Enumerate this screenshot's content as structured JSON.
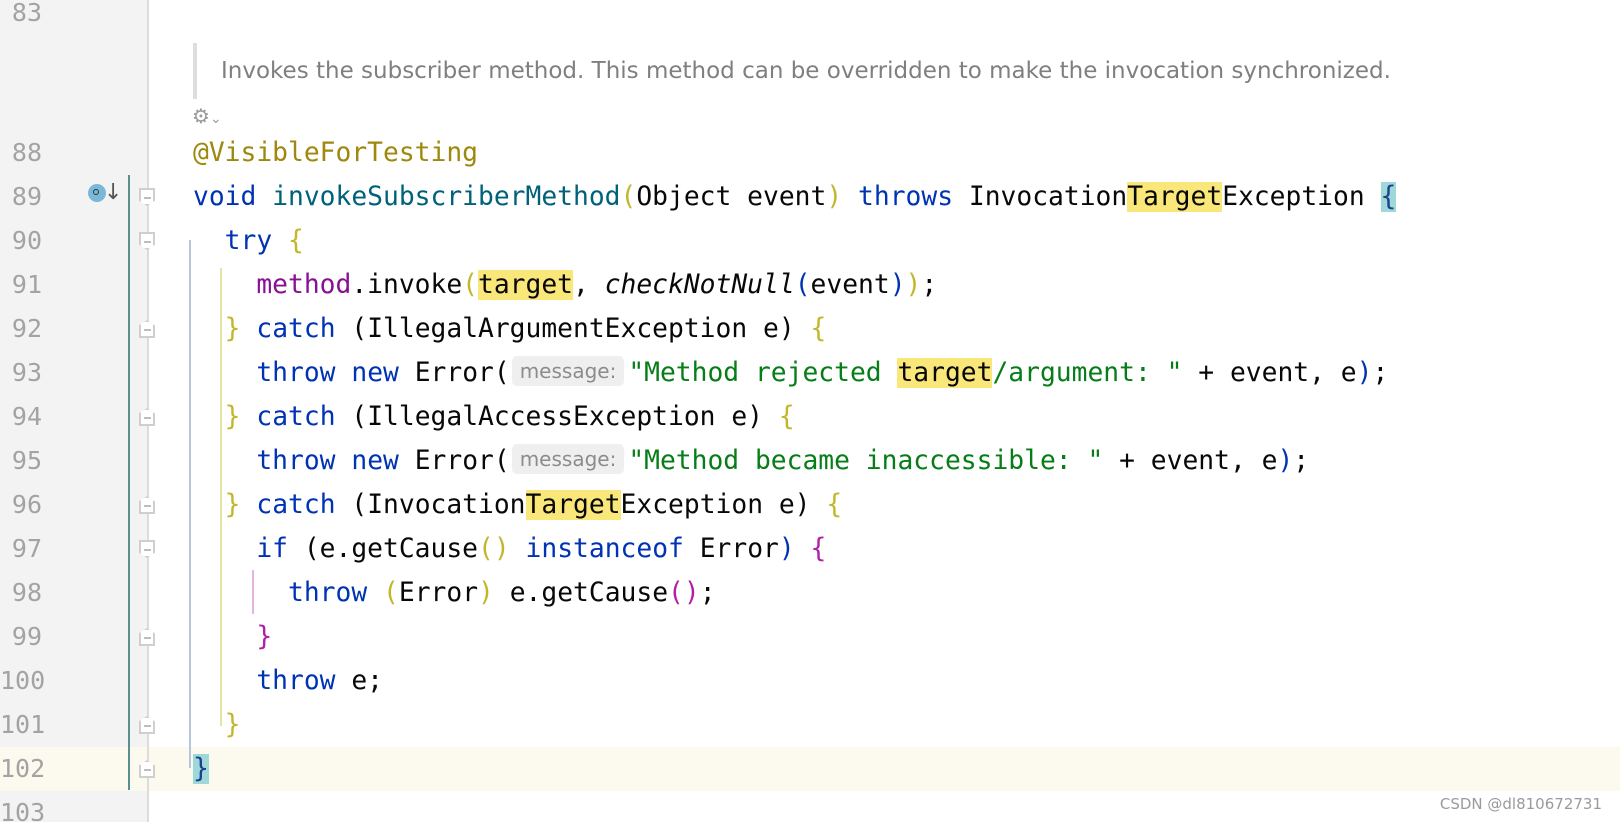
{
  "editor": {
    "doc_comment": "Invokes the subscriber method. This method can be overridden to make the invocation synchronized.",
    "doc_toggle_icon": "render-doc-icon",
    "current_line": 102,
    "watermark": "CSDN @dl810672731",
    "colors": {
      "keyword": "#0033b3",
      "method": "#00627a",
      "annotation": "#9e880d",
      "string": "#067d17",
      "field": "#871094",
      "highlight": "#f9e77a",
      "current_line": "#fcfaee",
      "brace_match": "#9fd8d8"
    },
    "lines": [
      {
        "n": "83",
        "tokens": []
      },
      {
        "n": "88",
        "tokens": [
          [
            "@VisibleForTesting",
            "ann"
          ]
        ]
      },
      {
        "n": "89",
        "tokens": [
          [
            "void",
            "kw"
          ],
          [
            " ",
            ""
          ],
          [
            "invokeSubscriberMethod",
            "fn"
          ],
          [
            "(",
            "b1"
          ],
          [
            "Object event",
            ""
          ],
          [
            ")",
            "b1"
          ],
          [
            " ",
            ""
          ],
          [
            "throws",
            "kw"
          ],
          [
            " Invocation",
            ""
          ],
          [
            "Target",
            "hl"
          ],
          [
            "Exception ",
            ""
          ],
          [
            "{",
            "cur"
          ]
        ]
      },
      {
        "n": "90",
        "tokens": [
          [
            "  ",
            ""
          ],
          [
            "try",
            "kw"
          ],
          [
            " ",
            ""
          ],
          [
            "{",
            "b1"
          ]
        ]
      },
      {
        "n": "91",
        "tokens": [
          [
            "    ",
            ""
          ],
          [
            "method",
            "fld"
          ],
          [
            ".invoke",
            ""
          ],
          [
            "(",
            "b1"
          ],
          [
            "target",
            "hl"
          ],
          [
            ", ",
            ""
          ],
          [
            "checkNotNull",
            "it"
          ],
          [
            "(",
            "b2"
          ],
          [
            "event",
            ""
          ],
          [
            ")",
            "b2"
          ],
          [
            ")",
            "b1"
          ],
          [
            ";",
            ""
          ]
        ]
      },
      {
        "n": "92",
        "tokens": [
          [
            "  ",
            ""
          ],
          [
            "}",
            "b1"
          ],
          [
            " ",
            ""
          ],
          [
            "catch",
            "kw"
          ],
          [
            " (IllegalArgumentException e) ",
            ""
          ],
          [
            "{",
            "b1"
          ]
        ]
      },
      {
        "n": "93",
        "tokens": [
          [
            "    ",
            ""
          ],
          [
            "throw",
            "kw"
          ],
          [
            " ",
            ""
          ],
          [
            "new",
            "kw"
          ],
          [
            " Error(",
            ""
          ],
          [
            "message:",
            "hint"
          ],
          [
            "\"Method rejected ",
            "str"
          ],
          [
            "target",
            "hl"
          ],
          [
            "/argument: \"",
            "str"
          ],
          [
            " + event, e",
            ""
          ],
          [
            ")",
            "b2"
          ],
          [
            ";",
            ""
          ]
        ]
      },
      {
        "n": "94",
        "tokens": [
          [
            "  ",
            ""
          ],
          [
            "}",
            "b1"
          ],
          [
            " ",
            ""
          ],
          [
            "catch",
            "kw"
          ],
          [
            " (IllegalAccessException e) ",
            ""
          ],
          [
            "{",
            "b1"
          ]
        ]
      },
      {
        "n": "95",
        "tokens": [
          [
            "    ",
            ""
          ],
          [
            "throw",
            "kw"
          ],
          [
            " ",
            ""
          ],
          [
            "new",
            "kw"
          ],
          [
            " Error(",
            ""
          ],
          [
            "message:",
            "hint"
          ],
          [
            "\"Method became inaccessible: \"",
            "str"
          ],
          [
            " + event, e",
            ""
          ],
          [
            ")",
            "b2"
          ],
          [
            ";",
            ""
          ]
        ]
      },
      {
        "n": "96",
        "tokens": [
          [
            "  ",
            ""
          ],
          [
            "}",
            "b1"
          ],
          [
            " ",
            ""
          ],
          [
            "catch",
            "kw"
          ],
          [
            " (Invocation",
            ""
          ],
          [
            "Target",
            "hl"
          ],
          [
            "Exception e) ",
            ""
          ],
          [
            "{",
            "b1"
          ]
        ]
      },
      {
        "n": "97",
        "tokens": [
          [
            "    ",
            ""
          ],
          [
            "if",
            "kw"
          ],
          [
            " (e.getCause",
            ""
          ],
          [
            "()",
            "b1"
          ],
          [
            " ",
            ""
          ],
          [
            "instanceof",
            "kw"
          ],
          [
            " Error",
            ""
          ],
          [
            ")",
            "b2"
          ],
          [
            " ",
            ""
          ],
          [
            "{",
            "b3"
          ]
        ]
      },
      {
        "n": "98",
        "tokens": [
          [
            "      ",
            ""
          ],
          [
            "throw",
            "kw"
          ],
          [
            " ",
            ""
          ],
          [
            "(",
            "b1"
          ],
          [
            "Error",
            ""
          ],
          [
            ")",
            "b1"
          ],
          [
            " e.getCause",
            ""
          ],
          [
            "()",
            "b3"
          ],
          [
            ";",
            ""
          ]
        ]
      },
      {
        "n": "99",
        "tokens": [
          [
            "    ",
            ""
          ],
          [
            "}",
            "b3"
          ]
        ]
      },
      {
        "n": "100",
        "tokens": [
          [
            "    ",
            ""
          ],
          [
            "throw",
            "kw"
          ],
          [
            " e;",
            ""
          ]
        ]
      },
      {
        "n": "101",
        "tokens": [
          [
            "  ",
            ""
          ],
          [
            "}",
            "b1"
          ]
        ]
      },
      {
        "n": "102",
        "tokens": [
          [
            "}",
            "cur"
          ]
        ]
      },
      {
        "n": "103",
        "tokens": []
      }
    ]
  }
}
